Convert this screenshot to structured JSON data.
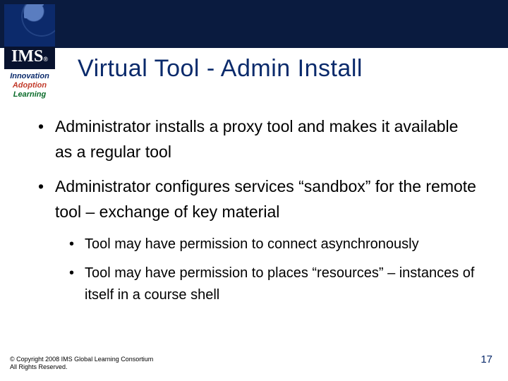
{
  "logo": {
    "acronym": "IMS",
    "reg": "®",
    "tagline1": "Innovation",
    "tagline2": "Adoption",
    "tagline3": "Learning"
  },
  "title": "Virtual Tool - Admin Install",
  "bullets": [
    {
      "text": "Administrator installs a proxy tool and makes it available as a regular tool"
    },
    {
      "text": "Administrator configures services “sandbox” for the remote tool – exchange of key material",
      "sub": [
        "Tool may have permission to connect asynchronously",
        "Tool may have permission to places “resources” – instances of itself in a course shell"
      ]
    }
  ],
  "footer": {
    "line1": "© Copyright 2008  IMS Global Learning Consortium",
    "line2": "All Rights Reserved."
  },
  "page_number": "17"
}
